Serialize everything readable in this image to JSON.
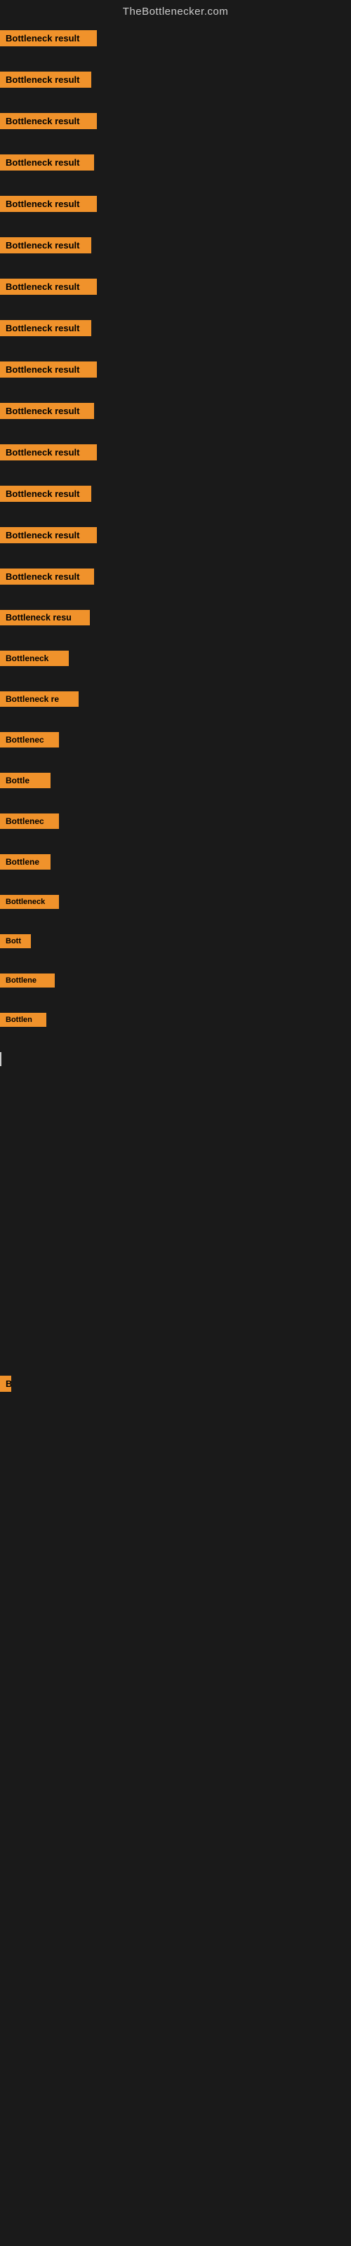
{
  "header": {
    "title": "TheBottlenecker.com"
  },
  "items": [
    {
      "id": 1,
      "label": "Bottleneck result"
    },
    {
      "id": 2,
      "label": "Bottleneck result"
    },
    {
      "id": 3,
      "label": "Bottleneck result"
    },
    {
      "id": 4,
      "label": "Bottleneck result"
    },
    {
      "id": 5,
      "label": "Bottleneck result"
    },
    {
      "id": 6,
      "label": "Bottleneck result"
    },
    {
      "id": 7,
      "label": "Bottleneck result"
    },
    {
      "id": 8,
      "label": "Bottleneck result"
    },
    {
      "id": 9,
      "label": "Bottleneck result"
    },
    {
      "id": 10,
      "label": "Bottleneck result"
    },
    {
      "id": 11,
      "label": "Bottleneck result"
    },
    {
      "id": 12,
      "label": "Bottleneck result"
    },
    {
      "id": 13,
      "label": "Bottleneck result"
    },
    {
      "id": 14,
      "label": "Bottleneck result"
    },
    {
      "id": 15,
      "label": "Bottleneck resu"
    },
    {
      "id": 16,
      "label": "Bottleneck"
    },
    {
      "id": 17,
      "label": "Bottleneck re"
    },
    {
      "id": 18,
      "label": "Bottlenec"
    },
    {
      "id": 19,
      "label": "Bottle"
    },
    {
      "id": 20,
      "label": "Bottlenec"
    },
    {
      "id": 21,
      "label": "Bottlene"
    },
    {
      "id": 22,
      "label": "Bottleneck"
    },
    {
      "id": 23,
      "label": "Bott"
    },
    {
      "id": 24,
      "label": "Bottlene"
    },
    {
      "id": 25,
      "label": "Bottlen"
    },
    {
      "id": 26,
      "label": "B"
    }
  ],
  "colors": {
    "badge_bg": "#f0922b",
    "badge_text": "#000000",
    "body_bg": "#1a1a1a",
    "header_text": "#cccccc"
  }
}
